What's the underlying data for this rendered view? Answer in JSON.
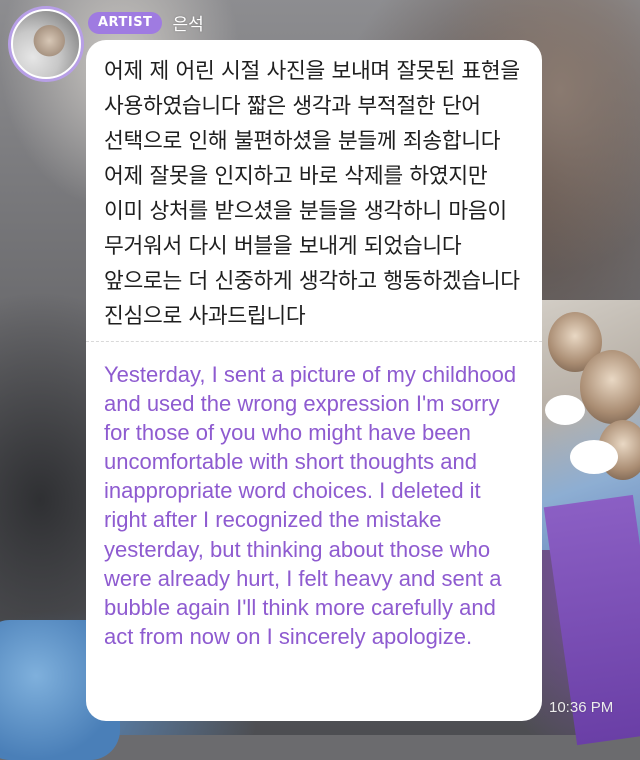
{
  "header": {
    "badge_label": "ARTIST",
    "artist_name": "은석"
  },
  "message": {
    "korean_text": "어제 제 어린 시절 사진을 보내며 잘못된 표현을 사용하였습니다 짧은 생각과 부적절한 단어 선택으로 인해 불편하셨을 분들께 죄송합니다 어제 잘못을 인지하고 바로 삭제를 하였지만 이미 상처를 받으셨을 분들을 생각하니 마음이 무거워서 다시 버블을 보내게 되었습니다 앞으로는 더 신중하게 생각하고 행동하겠습니다 진심으로 사과드립니다",
    "english_text": "Yesterday, I sent a picture of my childhood and used the wrong expression I'm sorry for those of you who might have been uncomfortable with short thoughts and inappropriate word choices. I deleted it right after I recognized the mistake yesterday, but thinking about those who were already hurt, I felt heavy and sent a bubble again I'll think more carefully and act from now on I sincerely apologize.",
    "timestamp": "10:36 PM"
  },
  "colors": {
    "badge": "#9f7be1",
    "translation_text": "#8e5bd0",
    "bubble_background": "#ffffff"
  },
  "icons": {
    "avatar": "artist-avatar-photo"
  }
}
